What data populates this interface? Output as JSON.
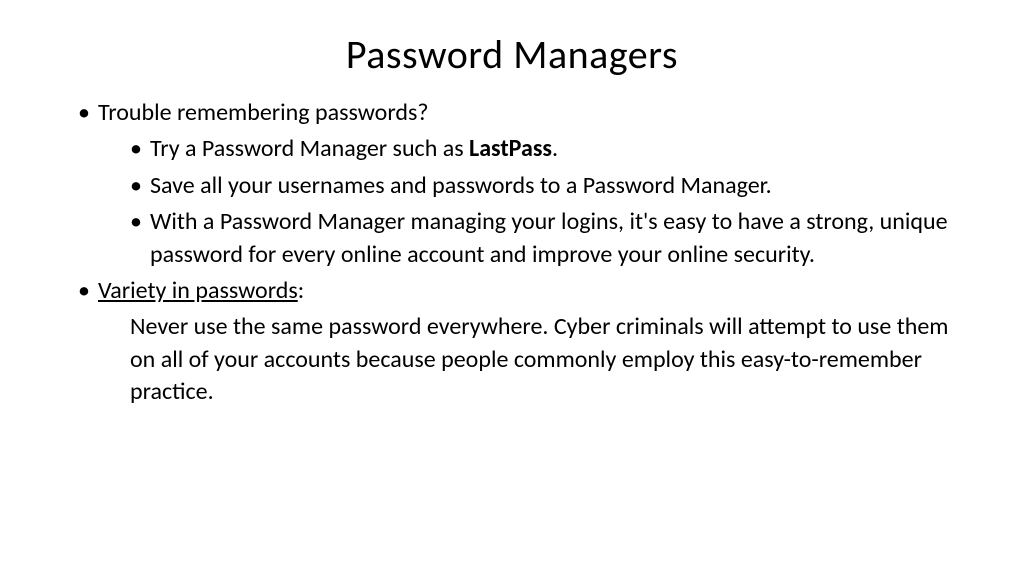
{
  "title": "Password Managers",
  "bullets": {
    "item1": "Trouble remembering passwords?",
    "sub1_prefix": "Try a Password Manager such as ",
    "sub1_bold": "LastPass",
    "sub1_suffix": ".",
    "sub2": "Save all your usernames and passwords to a Password Manager.",
    "sub3": "With a Password Manager managing your logins, it's easy to have a strong, unique password for every online account and improve your online security.",
    "item2_underline": "Variety in passwords",
    "item2_suffix": ":",
    "para2": "Never use the same password everywhere. Cyber criminals will attempt to use them on all of your accounts because people commonly employ this easy-to-remember practice."
  }
}
